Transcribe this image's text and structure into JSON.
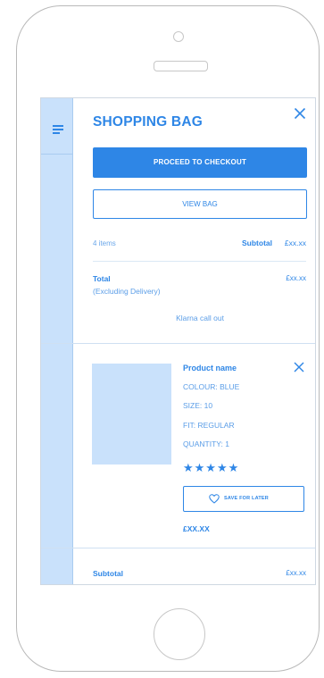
{
  "header": {
    "title": "SHOPPING BAG",
    "menu_icon": "hamburger-icon",
    "close_icon": "close-icon"
  },
  "actions": {
    "checkout_label": "PROCEED TO CHECKOUT",
    "view_bag_label": "VIEW BAG"
  },
  "summary": {
    "items_count": "4 items",
    "subtotal_label": "Subtotal",
    "subtotal_value": "£xx.xx",
    "total_label": "Total",
    "total_note": "(Excluding Delivery)",
    "total_value": "£xx.xx",
    "klarna_text": "Klarna call out"
  },
  "product": {
    "name": "Product name",
    "colour": "COLOUR: BLUE",
    "size": "SIZE: 10",
    "fit": "FIT: REGULAR",
    "quantity": "QUANTITY: 1",
    "rating": 5,
    "stars": "★★★★★",
    "save_label": "SAVE FOR LATER",
    "save_icon": "heart-icon",
    "price": "£XX.XX"
  },
  "footer": {
    "subtotal_label": "Subtotal",
    "subtotal_value": "£xx.xx"
  },
  "colors": {
    "accent": "#2e86e6",
    "light_accent": "#c9e1fb"
  }
}
